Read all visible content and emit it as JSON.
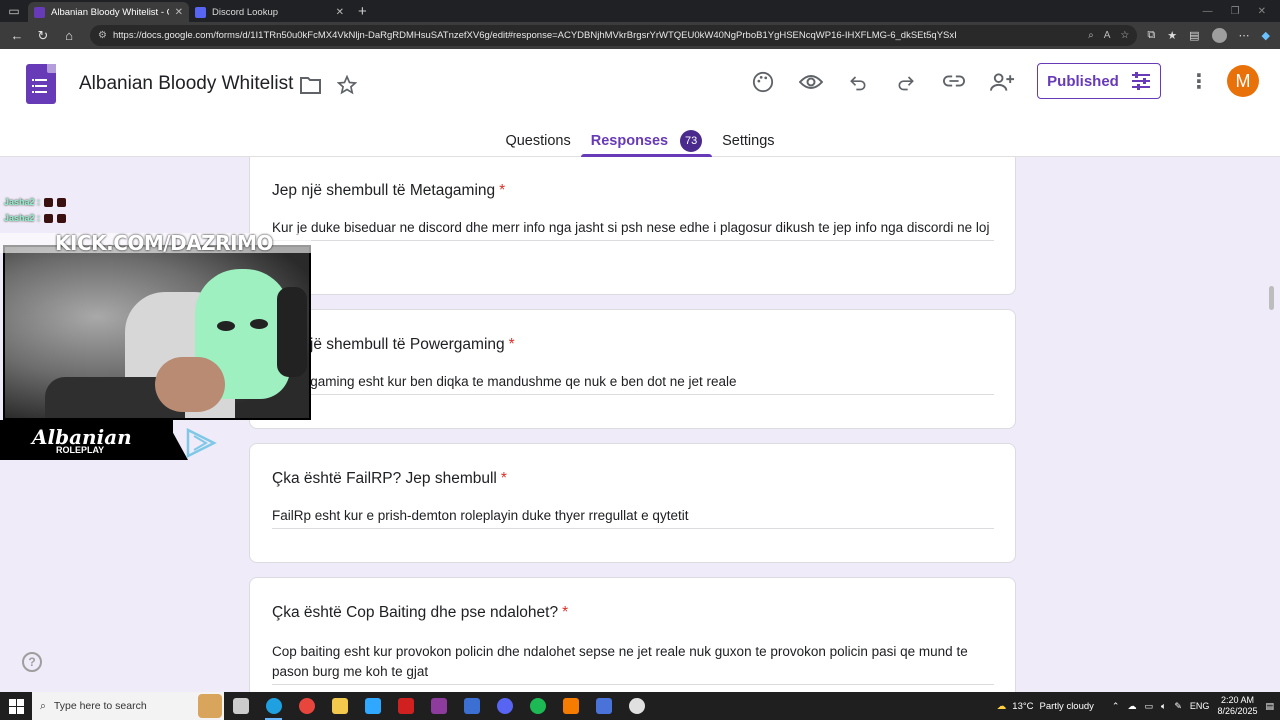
{
  "browser": {
    "tabs": [
      {
        "title": "Albanian Bloody Whitelist - Goog",
        "favicon_color": "#673ab7",
        "active": true
      },
      {
        "title": "Discord Lookup",
        "favicon_color": "#5865f2",
        "active": false
      }
    ],
    "url": "https://docs.google.com/forms/d/1I1TRn50u0kFcMX4VkNljn-DaRgRDMHsuSATnzefXV6g/edit#response=ACYDBNjhMVkrBrgsrYrWTQEU0kW40NgPrboB1YgHSENcqWP16-IHXFLMG-6_dkSEt5qYSxI"
  },
  "form": {
    "title": "Albanian Bloody Whitelist",
    "published_label": "Published",
    "avatar_letter": "M",
    "tabs": {
      "questions": "Questions",
      "responses": "Responses",
      "responses_count": "73",
      "settings": "Settings"
    }
  },
  "questions": [
    {
      "title": "Jep një shembull të Metagaming",
      "required_mark": "*",
      "answer": "Kur je duke biseduar ne discord dhe merr info nga jasht si psh nese edhe i plagosur dikush te jep info nga discordi ne loj"
    },
    {
      "title": "Jep një shembull të Powergaming",
      "required_mark": "*",
      "answer": "Powergaming esht kur ben diqka te mandushme qe nuk e ben dot ne jet reale"
    },
    {
      "title": "Çka është FailRP? Jep shembull",
      "required_mark": "*",
      "answer": "FailRp esht kur e prish-demton roleplayin duke thyer rregullat e qytetit"
    },
    {
      "title": "Çka është Cop Baiting dhe pse ndalohet?",
      "required_mark": "*",
      "answer": "Cop baiting esht kur provokon policin dhe ndalohet sepse ne jet reale nuk guxon te provokon policin pasi qe mund te pason burg me koh te gjat"
    }
  ],
  "overlay": {
    "chat": [
      {
        "user": "Jasha2 :"
      },
      {
        "user": "Jasha2 :"
      }
    ],
    "kick_text": "KICK.COM/DAZRIMO",
    "brand_name": "Albanian",
    "brand_sub": "ROLEPLAY"
  },
  "taskbar": {
    "search_placeholder": "Type here to search",
    "weather_temp": "13°C",
    "weather_text": "Partly cloudy",
    "language": "ENG",
    "time": "2:20 AM",
    "date": "8/26/2025",
    "apps": [
      {
        "name": "task-view",
        "color": "#cccccc"
      },
      {
        "name": "edge",
        "color": "#1fa0e0"
      },
      {
        "name": "chrome",
        "color": "#e8453c"
      },
      {
        "name": "file-explorer",
        "color": "#f2c94c"
      },
      {
        "name": "photoshop",
        "color": "#31a8ff"
      },
      {
        "name": "app-red",
        "color": "#d12020"
      },
      {
        "name": "winrar",
        "color": "#8e3b9e"
      },
      {
        "name": "app-blue",
        "color": "#3b6fd1"
      },
      {
        "name": "discord",
        "color": "#5865f2"
      },
      {
        "name": "spotify",
        "color": "#1db954"
      },
      {
        "name": "app-orange",
        "color": "#f57c00"
      },
      {
        "name": "app-install",
        "color": "#4a73d9"
      },
      {
        "name": "app-circle",
        "color": "#e0e0e0"
      }
    ]
  },
  "colors": {
    "accent": "#673ab7",
    "background": "#f0ebf8",
    "required": "#d93025"
  }
}
